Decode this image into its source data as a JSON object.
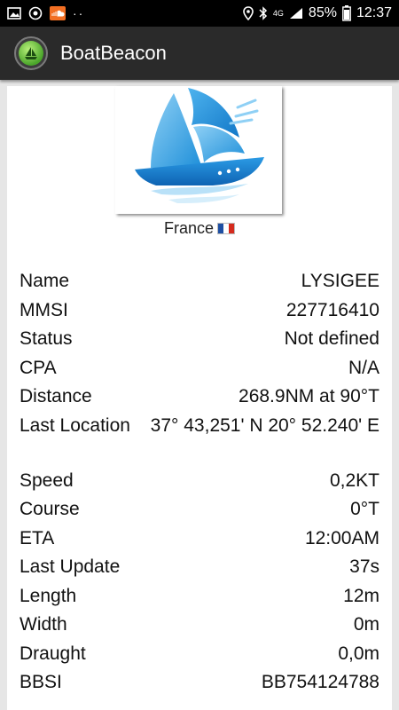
{
  "status_bar": {
    "battery": "85%",
    "time": "12:37",
    "network": "4G"
  },
  "app_bar": {
    "title": "BoatBeacon"
  },
  "vessel": {
    "country": "France"
  },
  "details": [
    {
      "key": "name",
      "label": "Name",
      "value": "LYSIGEE"
    },
    {
      "key": "mmsi",
      "label": "MMSI",
      "value": "227716410"
    },
    {
      "key": "status",
      "label": "Status",
      "value": "Not defined"
    },
    {
      "key": "cpa",
      "label": "CPA",
      "value": "N/A"
    },
    {
      "key": "distance",
      "label": "Distance",
      "value": "268.9NM at 90°T"
    },
    {
      "key": "last-location",
      "label": "Last Location",
      "value": "37° 43,251' N 20° 52.240' E"
    },
    {
      "key": "speed",
      "label": "Speed",
      "value": "0,2KT"
    },
    {
      "key": "course",
      "label": "Course",
      "value": "0°T"
    },
    {
      "key": "eta",
      "label": "ETA",
      "value": "12:00AM"
    },
    {
      "key": "last-update",
      "label": "Last Update",
      "value": "37s"
    },
    {
      "key": "length",
      "label": "Length",
      "value": "12m"
    },
    {
      "key": "width",
      "label": "Width",
      "value": "0m"
    },
    {
      "key": "draught",
      "label": "Draught",
      "value": "0,0m"
    },
    {
      "key": "bbsi",
      "label": "BBSI",
      "value": "BB754124788"
    }
  ]
}
